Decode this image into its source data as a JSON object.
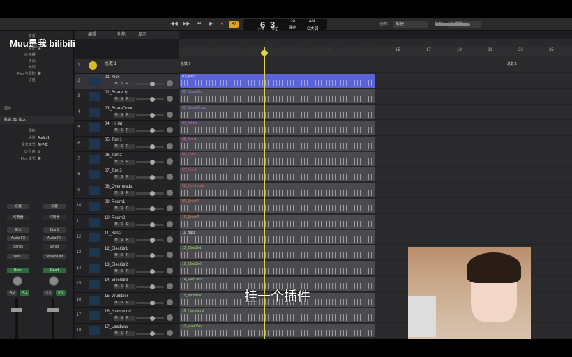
{
  "watermark": "Muu是我 bilibili",
  "subtitle": "挂一个插件",
  "lcd": {
    "bar": "6",
    "beat": "3",
    "bar_label": "小节",
    "beat_label": "节拍",
    "tempo": "120",
    "tempo_label": "保持",
    "sig": "4/4",
    "key": "C大调"
  },
  "toolbar": {
    "edit": "编辑",
    "snap_label": "吸附:",
    "snap_value": "敏捷",
    "drag_label": "拖移:",
    "drag_value": "无重叠",
    "func": "功能",
    "view": "显示"
  },
  "inspector": {
    "region_rows": [
      {
        "k": "静音:",
        "v": ""
      },
      {
        "k": "循环:",
        "v": ""
      },
      {
        "k": "量化:",
        "v": "关"
      },
      {
        "k": "Q-摇摆:",
        "v": ""
      },
      {
        "k": "移调:",
        "v": ""
      },
      {
        "k": "微调:",
        "v": ""
      },
      {
        "k": "Flex 与跟随:",
        "v": "关"
      },
      {
        "k": "增益:",
        "v": ""
      }
    ],
    "more": "更多",
    "track_label": "轨道: 01_Kick",
    "track_rows": [
      {
        "k": "图标:",
        "v": ""
      },
      {
        "k": "通道:",
        "v": "Audio 1"
      },
      {
        "k": "录音模式:",
        "v": "精子套"
      },
      {
        "k": "Q-引用:",
        "v": "☑"
      },
      {
        "k": "Flex 模式:",
        "v": "关"
      }
    ],
    "strips": [
      {
        "setting": "设置",
        "eq": "均衡器",
        "input": "输入",
        "effect": "Audio FX",
        "sends": "Sends",
        "out": "Bus 1",
        "auto": "Read",
        "vol": "-4.2",
        "peak": "-4.2"
      },
      {
        "setting": "设置",
        "eq": "均衡器",
        "input": "Bus 1",
        "effect": "Audio FX",
        "sends": "Sends",
        "out": "Stereo Out",
        "auto": "Read",
        "vol": "-2.6",
        "peak": "-7.0"
      }
    ]
  },
  "ruler": {
    "marks": [
      "1",
      "3",
      "5",
      "7",
      "9",
      "11",
      "13",
      "15",
      "17",
      "19",
      "21",
      "23",
      "25"
    ]
  },
  "folder": {
    "num": "1",
    "name": "总数 1",
    "region_name": "总数 1"
  },
  "tracks": [
    {
      "num": "2",
      "name": "01_Kick",
      "color": "#5a64d8",
      "label_color": "#e0e0ff"
    },
    {
      "num": "3",
      "name": "02_SnareUp",
      "color": "#4b4b4f",
      "label_color": "#7a8ce8"
    },
    {
      "num": "4",
      "name": "03_SnareDown",
      "color": "#4b4b4f",
      "label_color": "#9a7ae8"
    },
    {
      "num": "5",
      "name": "04_HiHat",
      "color": "#4b4b4f",
      "label_color": "#c46ae8"
    },
    {
      "num": "6",
      "name": "05_Tom1",
      "color": "#4b4b4f",
      "label_color": "#d85ab0"
    },
    {
      "num": "7",
      "name": "06_Tom2",
      "color": "#4b4b4f",
      "label_color": "#e8509a"
    },
    {
      "num": "8",
      "name": "07_Tom3",
      "color": "#4b4b4f",
      "label_color": "#e8507a"
    },
    {
      "num": "9",
      "name": "08_Overheads",
      "color": "#4b4b4f",
      "label_color": "#e86060"
    },
    {
      "num": "10",
      "name": "09_Room1",
      "color": "#4b4b4f",
      "label_color": "#e87050"
    },
    {
      "num": "11",
      "name": "10_Room2",
      "color": "#4b4b4f",
      "label_color": "#e88a50"
    },
    {
      "num": "12",
      "name": "11_Bass",
      "color": "#4b4b4f",
      "label_color": "#e8e8e8"
    },
    {
      "num": "13",
      "name": "12_ElecGtr1",
      "color": "#4b4b4f",
      "label_color": "#9ad860"
    },
    {
      "num": "14",
      "name": "13_ElecGtr2",
      "color": "#4b4b4f",
      "label_color": "#9ad860"
    },
    {
      "num": "15",
      "name": "14_ElecGtr3",
      "color": "#4b4b4f",
      "label_color": "#9ad860"
    },
    {
      "num": "16",
      "name": "15_Wurlitzer",
      "color": "#4b4b4f",
      "label_color": "#9ad860"
    },
    {
      "num": "17",
      "name": "16_Hammond",
      "color": "#4b4b4f",
      "label_color": "#9ad860"
    },
    {
      "num": "18",
      "name": "17_LeadVox",
      "color": "#4b4b4f",
      "label_color": "#9ad860"
    }
  ],
  "track_buttons": {
    "m": "M",
    "s": "S",
    "r": "R",
    "i": "I"
  }
}
